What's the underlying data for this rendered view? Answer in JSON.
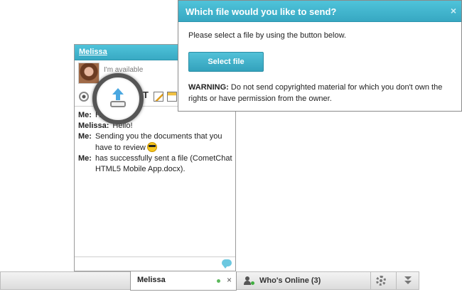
{
  "chat_window": {
    "title": "Melissa",
    "status_message": "I'm available",
    "messages": [
      {
        "sender": "Me:",
        "text": "Hi"
      },
      {
        "sender": "Melissa:",
        "text": "Hello!"
      },
      {
        "sender": "Me:",
        "text": "Sending you the documents that you have to review",
        "emoticon": "cool-sunglasses-emoticon"
      },
      {
        "sender": "Me:",
        "text": "has successfully sent a file (CometChat HTML5 Mobile App.docx)."
      }
    ],
    "toolbar_icons": [
      "webcam-icon",
      "file-transfer-icon",
      "text-style-icon",
      "whiteboard-icon",
      "documents-icon"
    ]
  },
  "dialog": {
    "title": "Which file would you like to send?",
    "close_label": "×",
    "instructions": "Please select a file by using the button below.",
    "select_file_label": "Select file",
    "warning_label": "WARNING:",
    "warning_text": "Do not send copyrighted material for which you don't own the rights or have permission from the owner."
  },
  "bottom_bar": {
    "chat_tab_label": "Melissa",
    "chat_tab_close": "×",
    "whos_online_label": "Who's Online (3)"
  },
  "colors": {
    "accent": "#3fb4cd",
    "online": "#5cb85c"
  }
}
